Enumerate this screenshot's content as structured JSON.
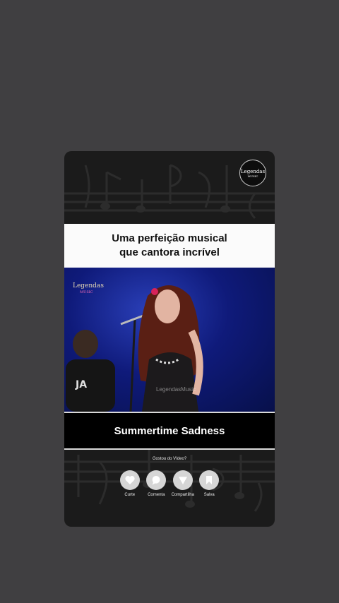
{
  "headline": {
    "line1": "Uma perfeição musical",
    "line2": "que cantora incrível"
  },
  "logo": {
    "name": "Legendas",
    "sub": "MUSIC"
  },
  "video": {
    "watermark": "Legendas",
    "watermark_sub": "MUSIC",
    "watermark_center": "LegendasMusic"
  },
  "song_title": "Summertime Sadness",
  "engagement": {
    "prompt": "Gostou do Vídeo?",
    "actions": [
      {
        "label": "Curte",
        "icon": "heart-icon"
      },
      {
        "label": "Comenta",
        "icon": "comment-icon"
      },
      {
        "label": "Compartilha",
        "icon": "share-icon"
      },
      {
        "label": "Salva",
        "icon": "bookmark-icon"
      }
    ]
  },
  "colors": {
    "page_bg": "#403f41",
    "card_bg": "#1b1b1b",
    "video_blue": "#0f1a7a",
    "icon_circle": "#d6d6d6"
  }
}
